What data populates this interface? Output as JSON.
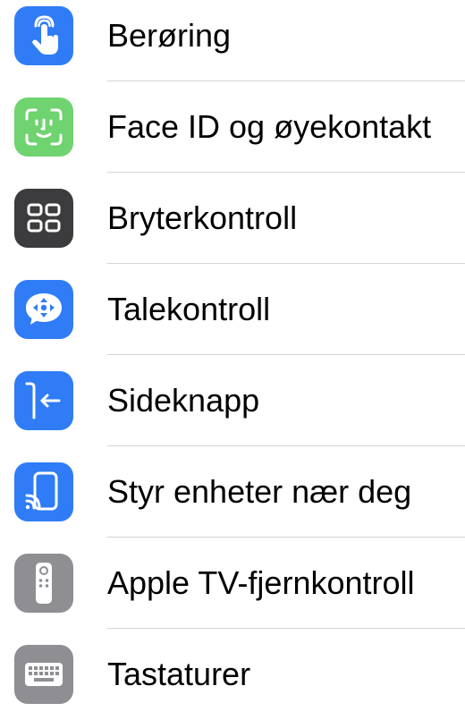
{
  "items": [
    {
      "label": "Berøring",
      "icon": "touch-hand-icon",
      "color": "#2f7cf6"
    },
    {
      "label": "Face ID og øyekontakt",
      "icon": "face-id-icon",
      "color": "#6fd36f"
    },
    {
      "label": "Bryterkontroll",
      "icon": "switch-grid-icon",
      "color": "#3c3c3e"
    },
    {
      "label": "Talekontroll",
      "icon": "voice-control-icon",
      "color": "#2f7cf6"
    },
    {
      "label": "Sideknapp",
      "icon": "side-button-icon",
      "color": "#2f7cf6"
    },
    {
      "label": "Styr enheter nær deg",
      "icon": "nearby-devices-icon",
      "color": "#2f7cf6"
    },
    {
      "label": "Apple TV-fjernkontroll",
      "icon": "tv-remote-icon",
      "color": "#8e8e93"
    },
    {
      "label": "Tastaturer",
      "icon": "keyboard-icon",
      "color": "#8e8e93"
    }
  ]
}
